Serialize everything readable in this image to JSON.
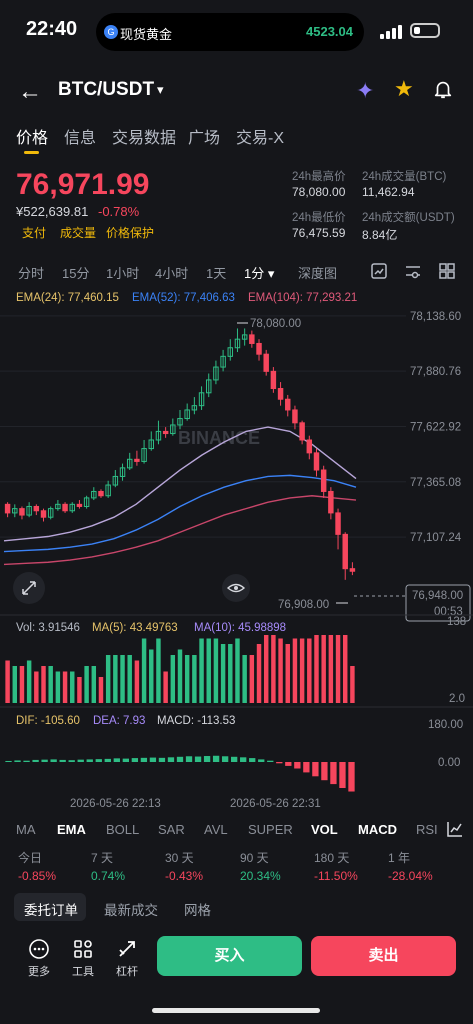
{
  "status_bar": {
    "time": "22:40",
    "island_label": "现货黄金",
    "island_coin": "G",
    "island_value": "4523.04"
  },
  "header": {
    "pair": "BTC/USDT",
    "caret": "▾"
  },
  "tabs": [
    "价格",
    "信息",
    "交易数据",
    "广场",
    "交易-X"
  ],
  "price": {
    "last": "76,971.99",
    "cny": "¥522,639.81",
    "change": "-0.78%",
    "links": [
      "支付",
      "成交量",
      "价格保护"
    ]
  },
  "stats": {
    "high_label": "24h最高价",
    "high": "78,080.00",
    "vol_btc_label": "24h成交量(BTC)",
    "vol_btc": "11,462.94",
    "low_label": "24h最低价",
    "low": "76,475.59",
    "vol_usdt_label": "24h成交额(USDT)",
    "vol_usdt": "8.84亿"
  },
  "intervals": [
    "分时",
    "15分",
    "1小时",
    "4小时",
    "1天",
    "1分 ▾",
    "深度图"
  ],
  "active_interval": "1分 ▾",
  "chart": {
    "ema24_label": "EMA(24): 77,460.15",
    "ema52_label": "EMA(52): 77,406.63",
    "ema104_label": "EMA(104): 77,293.21",
    "price_ticks": [
      "78,138.60",
      "77,880.76",
      "77,622.92",
      "77,365.08",
      "77,107.24"
    ],
    "high_marker": "78,080.00",
    "low_marker": "76,908.00",
    "current_price": "76,948.00",
    "countdown": "00:53",
    "watermark": "BINANCE",
    "vol_label": "Vol: 3.91546",
    "ma5_label": "MA(5): 43.49763",
    "ma10_label": "MA(10): 45.98898",
    "vol_ticks": [
      "138",
      "2.0"
    ],
    "dif_label": "DIF: -105.60",
    "dea_label": "DEA: 7.93",
    "macd_label": "MACD: -113.53",
    "macd_ticks": [
      "180.00",
      "0.00"
    ],
    "time_ticks": [
      "2026-05-26 22:13",
      "2026-05-26 22:31"
    ],
    "colors": {
      "up": "#2ebd85",
      "down": "#f6465d",
      "ema24": "#e6c36a",
      "ema52": "#3b82f6",
      "ema104": "#c8466a"
    }
  },
  "chart_data": {
    "type": "candlestick",
    "ylim": [
      76800,
      78180
    ],
    "ema_series": [
      {
        "name": "EMA(24)",
        "values": [
          77090,
          77100,
          77110,
          77130,
          77160,
          77200,
          77260,
          77340,
          77420,
          77490,
          77550,
          77600,
          77620,
          77600,
          77540,
          77460,
          77380
        ]
      },
      {
        "name": "EMA(52)",
        "values": [
          77040,
          77045,
          77050,
          77060,
          77075,
          77100,
          77140,
          77190,
          77250,
          77300,
          77340,
          77370,
          77390,
          77395,
          77385,
          77370,
          77340
        ]
      },
      {
        "name": "EMA(104)",
        "values": [
          76980,
          76985,
          76990,
          77000,
          77015,
          77035,
          77060,
          77090,
          77130,
          77170,
          77210,
          77240,
          77270,
          77290,
          77300,
          77290,
          77280
        ]
      }
    ],
    "candles": [
      [
        77260,
        77220,
        77270,
        77200
      ],
      [
        77220,
        77240,
        77260,
        77200
      ],
      [
        77240,
        77210,
        77250,
        77190
      ],
      [
        77210,
        77250,
        77270,
        77200
      ],
      [
        77250,
        77230,
        77260,
        77210
      ],
      [
        77230,
        77200,
        77240,
        77180
      ],
      [
        77200,
        77240,
        77250,
        77190
      ],
      [
        77240,
        77260,
        77280,
        77230
      ],
      [
        77260,
        77230,
        77270,
        77220
      ],
      [
        77230,
        77260,
        77270,
        77220
      ],
      [
        77260,
        77250,
        77280,
        77240
      ],
      [
        77250,
        77290,
        77300,
        77240
      ],
      [
        77290,
        77320,
        77340,
        77280
      ],
      [
        77320,
        77300,
        77330,
        77290
      ],
      [
        77300,
        77350,
        77370,
        77290
      ],
      [
        77350,
        77390,
        77420,
        77340
      ],
      [
        77390,
        77430,
        77450,
        77370
      ],
      [
        77430,
        77470,
        77500,
        77420
      ],
      [
        77470,
        77460,
        77510,
        77440
      ],
      [
        77460,
        77520,
        77560,
        77450
      ],
      [
        77520,
        77560,
        77600,
        77510
      ],
      [
        77560,
        77600,
        77650,
        77540
      ],
      [
        77600,
        77590,
        77620,
        77570
      ],
      [
        77590,
        77630,
        77660,
        77580
      ],
      [
        77630,
        77660,
        77700,
        77610
      ],
      [
        77660,
        77700,
        77730,
        77650
      ],
      [
        77700,
        77720,
        77760,
        77680
      ],
      [
        77720,
        77780,
        77810,
        77700
      ],
      [
        77780,
        77840,
        77870,
        77760
      ],
      [
        77840,
        77900,
        77930,
        77820
      ],
      [
        77900,
        77950,
        77980,
        77880
      ],
      [
        77950,
        77990,
        78030,
        77930
      ],
      [
        77990,
        78030,
        78080,
        77970
      ],
      [
        78030,
        78050,
        78080,
        78000
      ],
      [
        78050,
        78010,
        78070,
        77990
      ],
      [
        78010,
        77960,
        78030,
        77930
      ],
      [
        77960,
        77880,
        77980,
        77860
      ],
      [
        77880,
        77800,
        77900,
        77780
      ],
      [
        77800,
        77750,
        77830,
        77720
      ],
      [
        77750,
        77700,
        77770,
        77670
      ],
      [
        77700,
        77640,
        77720,
        77610
      ],
      [
        77640,
        77560,
        77650,
        77540
      ],
      [
        77560,
        77500,
        77580,
        77470
      ],
      [
        77500,
        77420,
        77520,
        77390
      ],
      [
        77420,
        77320,
        77440,
        77290
      ],
      [
        77320,
        77220,
        77340,
        77190
      ],
      [
        77220,
        77120,
        77240,
        77050
      ],
      [
        77120,
        76960,
        77130,
        76908
      ],
      [
        76960,
        76948,
        76990,
        76930
      ]
    ],
    "macd_hist": [
      4,
      6,
      5,
      8,
      9,
      10,
      8,
      7,
      9,
      10,
      11,
      12,
      14,
      13,
      15,
      16,
      17,
      16,
      18,
      20,
      22,
      21,
      23,
      24,
      22,
      20,
      18,
      15,
      10,
      5,
      -5,
      -15,
      -25,
      -40,
      -55,
      -70,
      -85,
      -100,
      -113.53
    ]
  },
  "indicator_tabs": [
    "MA",
    "EMA",
    "BOLL",
    "SAR",
    "AVL",
    "SUPER",
    "VOL",
    "MACD",
    "RSI"
  ],
  "performance": [
    {
      "label": "今日",
      "value": "-0.85%",
      "dir": "down"
    },
    {
      "label": "7 天",
      "value": "0.74%",
      "dir": "up"
    },
    {
      "label": "30 天",
      "value": "-0.43%",
      "dir": "down"
    },
    {
      "label": "90 天",
      "value": "20.34%",
      "dir": "up"
    },
    {
      "label": "180 天",
      "value": "-11.50%",
      "dir": "down"
    },
    {
      "label": "1 年",
      "value": "-28.04%",
      "dir": "down"
    }
  ],
  "order_tabs": [
    "委托订单",
    "最新成交",
    "网格"
  ],
  "bottom": {
    "more": "更多",
    "tools": "工具",
    "leverage": "杠杆",
    "buy": "买入",
    "sell": "卖出"
  }
}
